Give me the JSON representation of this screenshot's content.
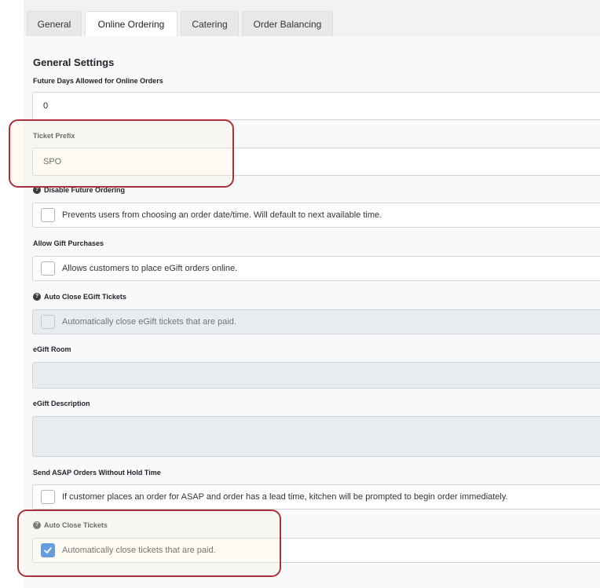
{
  "tabs": [
    {
      "label": "General",
      "active": false
    },
    {
      "label": "Online Ordering",
      "active": true
    },
    {
      "label": "Catering",
      "active": false
    },
    {
      "label": "Order Balancing",
      "active": false
    }
  ],
  "section_title": "General Settings",
  "fields": {
    "future_days": {
      "label": "Future Days Allowed for Online Orders",
      "value": "0"
    },
    "ticket_prefix": {
      "label": "Ticket Prefix",
      "value": "SPO"
    },
    "disable_future": {
      "label": "Disable Future Ordering",
      "text": "Prevents users from choosing an order date/time. Will default to next available time.",
      "checked": false
    },
    "gift_purchases": {
      "label": "Allow Gift Purchases",
      "text": "Allows customers to place eGift orders online.",
      "checked": false
    },
    "auto_close_egift": {
      "label": "Auto Close EGift Tickets",
      "text": "Automatically close eGift tickets that are paid.",
      "checked": false,
      "disabled": true
    },
    "egift_room": {
      "label": "eGift Room",
      "value": ""
    },
    "egift_description": {
      "label": "eGift Description",
      "value": ""
    },
    "send_asap": {
      "label": "Send ASAP Orders Without Hold Time",
      "text": "If customer places an order for ASAP and order has a lead time, kitchen will be prompted to begin order immediately.",
      "checked": false
    },
    "auto_close_tickets": {
      "label": "Auto Close Tickets",
      "text": "Automatically close tickets that are paid.",
      "checked": true
    }
  },
  "colors": {
    "accent": "#1a6fde",
    "highlight": "#a8313a"
  },
  "icons": {
    "help": "question-circle-icon",
    "check": "checkmark-icon"
  }
}
